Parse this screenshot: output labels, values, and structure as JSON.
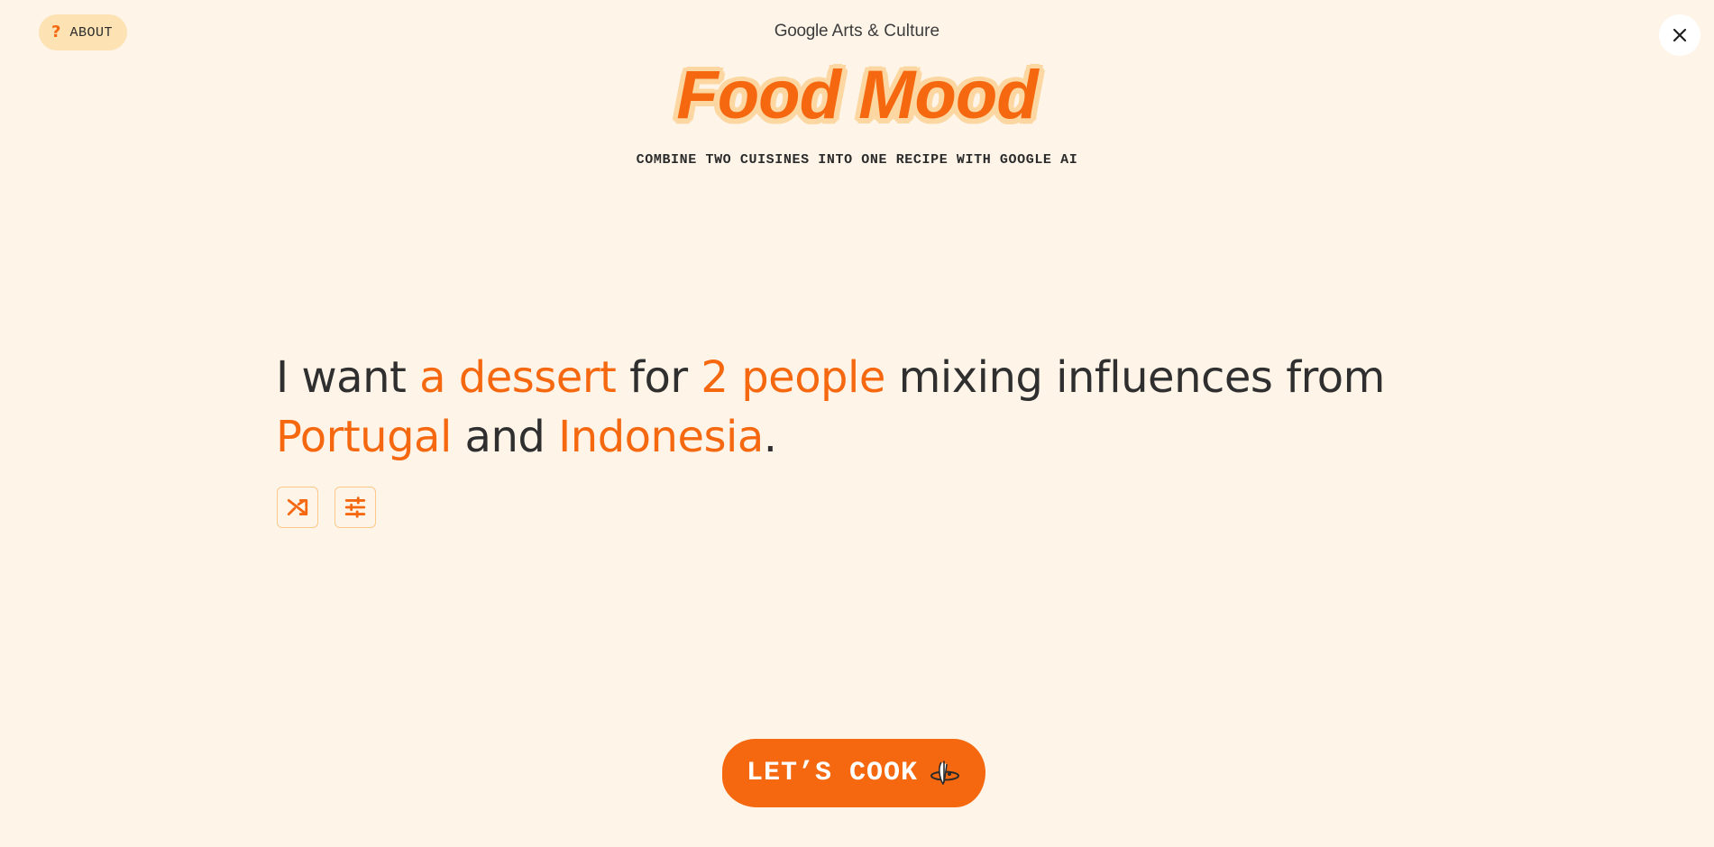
{
  "header": {
    "about_label": "ABOUT",
    "about_icon": "question-icon",
    "brand_google": "Google",
    "brand_rest": "Arts & Culture",
    "close_icon": "close-icon"
  },
  "hero": {
    "title": "Food Mood",
    "subtitle": "COMBINE TWO CUISINES INTO ONE RECIPE WITH GOOGLE AI"
  },
  "sentence": {
    "part1": "I want ",
    "dish": "a dessert",
    "part2": " for ",
    "people": "2 people",
    "part3": " mixing influences from ",
    "cuisine1": "Portugal",
    "part4": " and ",
    "cuisine2": "Indonesia",
    "part5": "."
  },
  "tools": {
    "shuffle_icon": "shuffle-icon",
    "settings_icon": "sliders-icon"
  },
  "cta": {
    "label": "LET’S COOK",
    "icon": "whisk-icon"
  },
  "colors": {
    "accent": "#f5680f",
    "background": "#fef4e8",
    "about_bg": "#fde2b3",
    "logo_outline": "#fcd7a2",
    "text": "#2f2f2f"
  }
}
